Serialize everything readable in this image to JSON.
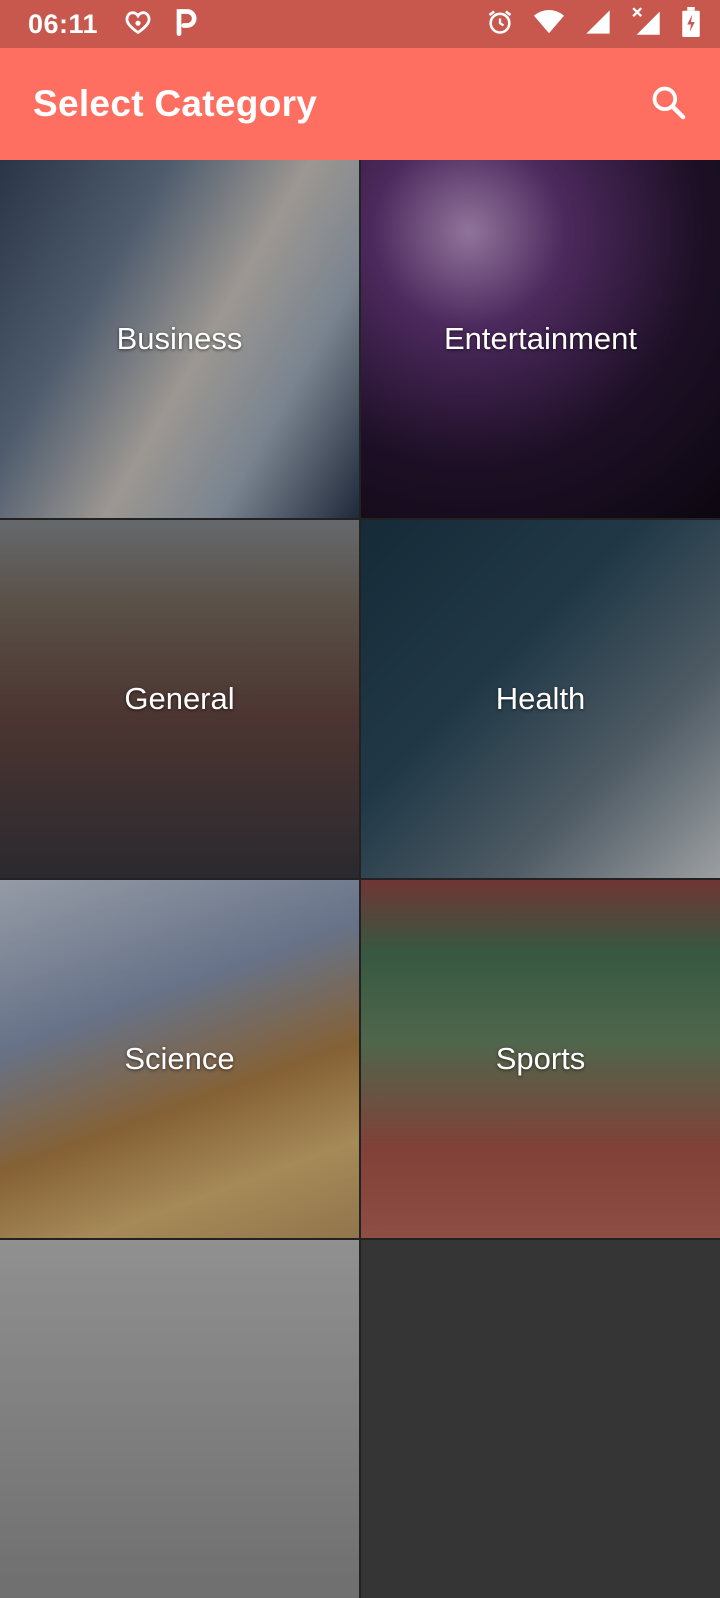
{
  "status_bar": {
    "time": "06:11",
    "left_icons": [
      "heart-app-icon",
      "p-app-icon"
    ],
    "right_icons": [
      "alarm-icon",
      "wifi-icon",
      "signal-icon",
      "signal-no-data-icon",
      "battery-charging-icon"
    ]
  },
  "app_bar": {
    "title": "Select Category",
    "search_icon": "search-icon"
  },
  "categories": [
    {
      "label": "Business"
    },
    {
      "label": "Entertainment"
    },
    {
      "label": "General"
    },
    {
      "label": "Health"
    },
    {
      "label": "Science"
    },
    {
      "label": "Sports"
    }
  ],
  "colors": {
    "status_bar": "#c8574d",
    "app_bar": "#fe6f61",
    "text": "#ffffff"
  }
}
